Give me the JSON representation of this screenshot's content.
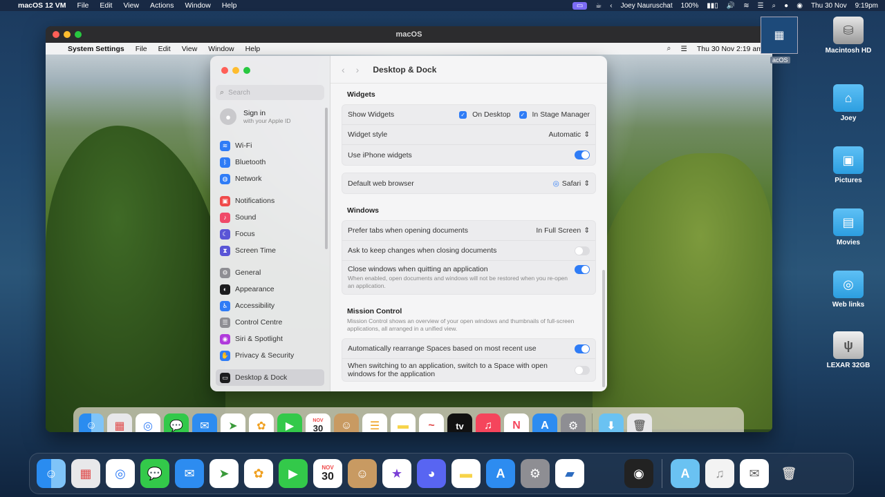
{
  "host_menubar": {
    "app_name": "macOS 12 VM",
    "menus": [
      "File",
      "Edit",
      "View",
      "Actions",
      "Window",
      "Help"
    ],
    "user": "Joey Nauruschat",
    "battery": "100%",
    "date": "Thu 30 Nov",
    "time": "9:19pm"
  },
  "vm_window": {
    "title": "macOS",
    "thumb_label": "acOS"
  },
  "guest_menubar": {
    "app_name": "System Settings",
    "menus": [
      "File",
      "Edit",
      "View",
      "Window",
      "Help"
    ],
    "clock": "Thu 30 Nov  2:19 am"
  },
  "sidebar": {
    "search_placeholder": "Search",
    "signin_title": "Sign in",
    "signin_sub": "with your Apple ID",
    "groups": [
      [
        {
          "label": "Wi-Fi",
          "icon": "wifi-icon",
          "color": "#2f7cf6"
        },
        {
          "label": "Bluetooth",
          "icon": "bluetooth-icon",
          "color": "#2f7cf6"
        },
        {
          "label": "Network",
          "icon": "network-icon",
          "color": "#2f7cf6"
        }
      ],
      [
        {
          "label": "Notifications",
          "icon": "notifications-icon",
          "color": "#f04a4a"
        },
        {
          "label": "Sound",
          "icon": "sound-icon",
          "color": "#f04a68"
        },
        {
          "label": "Focus",
          "icon": "focus-icon",
          "color": "#5a55d6"
        },
        {
          "label": "Screen Time",
          "icon": "screen-time-icon",
          "color": "#5a55d6"
        }
      ],
      [
        {
          "label": "General",
          "icon": "general-icon",
          "color": "#8e8e93"
        },
        {
          "label": "Appearance",
          "icon": "appearance-icon",
          "color": "#1c1c1e"
        },
        {
          "label": "Accessibility",
          "icon": "accessibility-icon",
          "color": "#2f7cf6"
        },
        {
          "label": "Control Centre",
          "icon": "control-centre-icon",
          "color": "#8e8e93"
        },
        {
          "label": "Siri & Spotlight",
          "icon": "siri-icon",
          "color": "#b03adb"
        },
        {
          "label": "Privacy & Security",
          "icon": "privacy-icon",
          "color": "#2f7cf6"
        }
      ],
      [
        {
          "label": "Desktop & Dock",
          "icon": "desktop-dock-icon",
          "color": "#1c1c1e"
        }
      ]
    ]
  },
  "content": {
    "title": "Desktop & Dock",
    "widgets": {
      "heading": "Widgets",
      "show_widgets": "Show Widgets",
      "on_desktop": "On Desktop",
      "in_stage_manager": "In Stage Manager",
      "widget_style": "Widget style",
      "widget_style_value": "Automatic",
      "use_iphone": "Use iPhone widgets"
    },
    "browser": {
      "label": "Default web browser",
      "value": "Safari"
    },
    "windows": {
      "heading": "Windows",
      "prefer_tabs": "Prefer tabs when opening documents",
      "prefer_tabs_value": "In Full Screen",
      "ask_keep": "Ask to keep changes when closing documents",
      "close_windows": "Close windows when quitting an application",
      "close_windows_desc": "When enabled, open documents and windows will not be restored when you re-open an application."
    },
    "mission": {
      "heading": "Mission Control",
      "desc": "Mission Control shows an overview of your open windows and thumbnails of full-screen applications, all arranged in a unified view.",
      "rearrange": "Automatically rearrange Spaces based on most recent use",
      "switching": "When switching to an application, switch to a Space with open windows for the application"
    }
  },
  "guest_dock": {
    "calendar_month": "NOV",
    "calendar_day": "30",
    "tv_label": "tv"
  },
  "desktop_icons": [
    "Macintosh HD",
    "Joey",
    "Pictures",
    "Movies",
    "Web links",
    "LEXAR 32GB"
  ],
  "host_dock": {
    "calendar_month": "NOV",
    "calendar_day": "30"
  }
}
